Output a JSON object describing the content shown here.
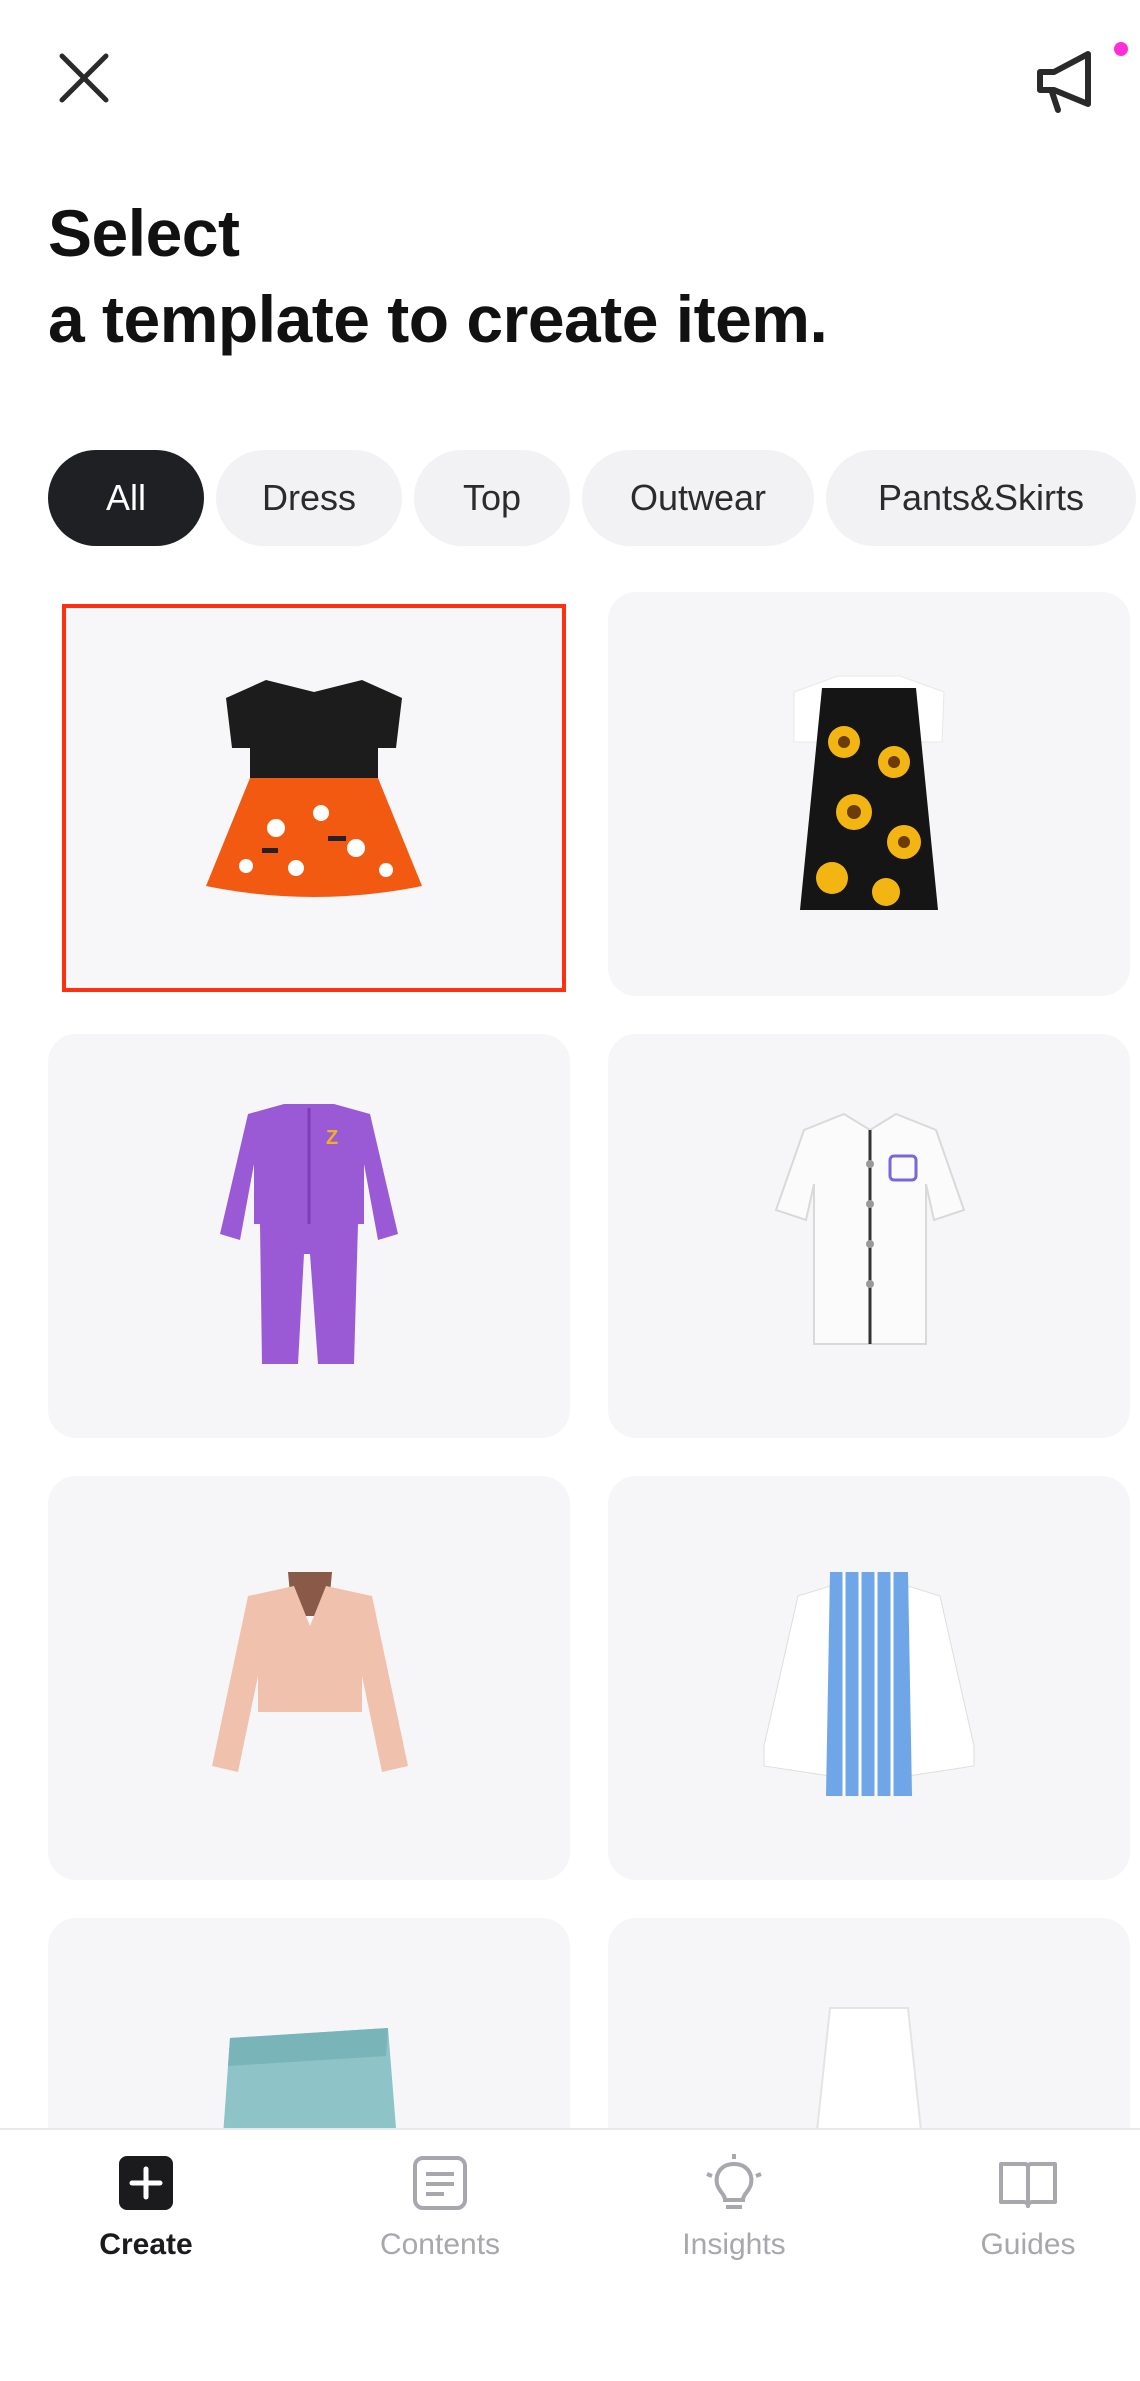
{
  "topbar": {
    "close_icon": "close-icon",
    "notice_icon": "megaphone-icon",
    "notice_dot_color": "#ff2fd8"
  },
  "heading": {
    "line1": "Select",
    "line2": "a template to create item."
  },
  "chips": [
    {
      "label": "All",
      "active": true
    },
    {
      "label": "Dress",
      "active": false
    },
    {
      "label": "Top",
      "active": false
    },
    {
      "label": "Outwear",
      "active": false
    },
    {
      "label": "Pants&Skirts",
      "active": false
    }
  ],
  "templates": [
    {
      "name": "halloween-dress",
      "selected": true
    },
    {
      "name": "sunflower-slip-dress",
      "selected": false
    },
    {
      "name": "purple-tracksuit",
      "selected": false
    },
    {
      "name": "baseball-jersey",
      "selected": false
    },
    {
      "name": "pink-off-shoulder-jacket",
      "selected": false
    },
    {
      "name": "striped-shirt",
      "selected": false
    },
    {
      "name": "teal-skirt",
      "selected": false
    },
    {
      "name": "white-skirt",
      "selected": false
    }
  ],
  "bottom_nav": [
    {
      "label": "Create",
      "icon": "plus-square-icon",
      "active": true
    },
    {
      "label": "Contents",
      "icon": "document-icon",
      "active": false
    },
    {
      "label": "Insights",
      "icon": "lightbulb-icon",
      "active": false
    },
    {
      "label": "Guides",
      "icon": "book-icon",
      "active": false
    }
  ],
  "colors": {
    "accent_dark": "#1f2023",
    "selection_border": "#ff2f10",
    "chip_bg": "#f2f2f4",
    "card_bg": "#f6f6f8"
  }
}
